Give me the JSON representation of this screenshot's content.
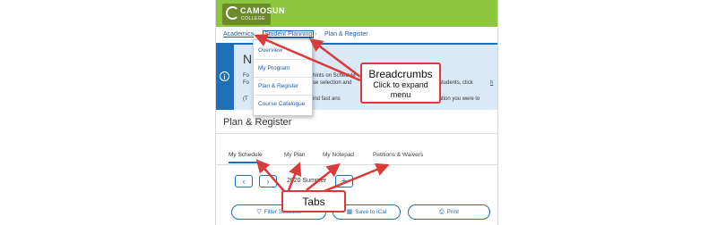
{
  "logo": {
    "name": "CAMOSUN",
    "sub": "COLLEGE"
  },
  "breadcrumbs": [
    "Academics",
    "Student Planning",
    "Plan & Register"
  ],
  "breadcrumb_separator": "›",
  "dropdown": {
    "items": [
      "Overview",
      "My Program",
      "Plan & Register",
      "Course Catalogue"
    ]
  },
  "notice": {
    "title": "N",
    "line1_left": "Fo",
    "line1_mid": "hints on Schedule",
    "line2_left": "Fo",
    "line2_mid": "se selection and",
    "line2_right": "onal students, click",
    "line2_link": "h",
    "line3_left": "(T",
    "line3_mid": "ation, find fast ans",
    "line3_right": "information you were lo",
    "icon": "info-icon"
  },
  "page": {
    "title": "Plan & Register"
  },
  "tabs": [
    "My Schedule",
    "My Plan",
    "My Notepad",
    "Petitions & Waivers"
  ],
  "term": {
    "label": "2020 Summer",
    "prev": "‹",
    "next": "›",
    "add": "+"
  },
  "actions": [
    "Filter Sections",
    "Save to iCal",
    "Print"
  ],
  "callouts": {
    "breadcrumbs": {
      "title": "Breadcrumbs",
      "sub": "Click to expand menu"
    },
    "tabs": {
      "title": "Tabs"
    }
  },
  "colors": {
    "brand_green": "#8dc63f",
    "link_blue": "#1f5fa8",
    "annotation_red": "#d93a3a",
    "notice_blue": "#1e6fb8"
  }
}
